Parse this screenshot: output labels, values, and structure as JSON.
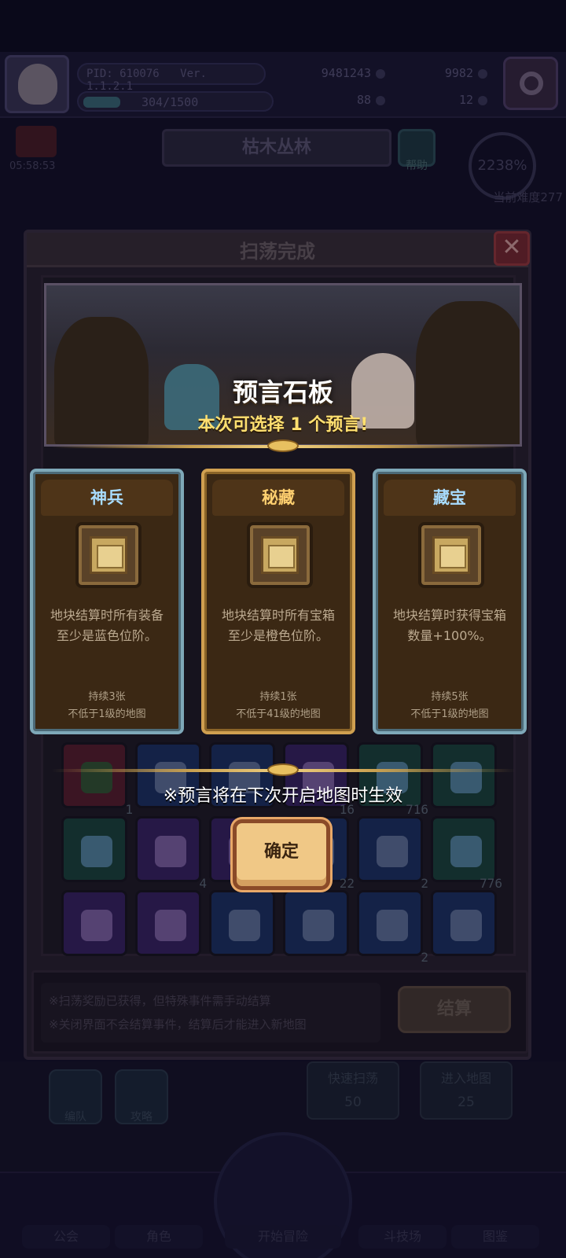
{
  "header": {
    "pid": "PID: 610076",
    "version": "Ver. 1.1.2.1",
    "exp": "304/1500",
    "exp_fraction": 0.2,
    "gold": "9481243",
    "gems": "9982",
    "resource_a": "88",
    "resource_b": "12",
    "timer": "05:58:53",
    "map_name": "枯木丛林",
    "help_label": "帮助",
    "progress_percent": "2238%",
    "difficulty": "当前难度277"
  },
  "dialog": {
    "title": "扫荡完成",
    "close_symbol": "✕",
    "notice_line1": "※扫荡奖励已获得，但特殊事件需手动结算",
    "notice_line2": "※关闭界面不会结算事件，结算后才能进入新地图",
    "settle_label": "结算",
    "item_rows": [
      [
        {
          "color": "red",
          "icon": "clover-icon",
          "count": "1"
        },
        {
          "color": "blue",
          "icon": "orb-icon",
          "count": ""
        },
        {
          "color": "blue",
          "icon": "scroll-icon",
          "count": ""
        },
        {
          "color": "purple",
          "icon": "gem-icon",
          "count": "16"
        },
        {
          "color": "green",
          "icon": "key-icon",
          "count": "716"
        },
        {
          "color": "green",
          "icon": "slime-icon",
          "count": ""
        }
      ],
      [
        {
          "color": "green",
          "icon": "witch-slime-icon",
          "count": ""
        },
        {
          "color": "purple",
          "icon": "mushroom-icon",
          "count": "4"
        },
        {
          "color": "purple",
          "icon": "bag-icon",
          "count": ""
        },
        {
          "color": "blue",
          "icon": "ore-icon",
          "count": "22"
        },
        {
          "color": "blue",
          "icon": "crystal-icon",
          "count": "2"
        },
        {
          "color": "green",
          "icon": "rune-icon",
          "count": "776"
        }
      ],
      [
        {
          "color": "purple",
          "icon": "necklace-icon",
          "count": ""
        },
        {
          "color": "purple",
          "icon": "heart-necklace-icon",
          "count": ""
        },
        {
          "color": "blue",
          "icon": "bow-icon",
          "count": ""
        },
        {
          "color": "blue",
          "icon": "staff-icon",
          "count": ""
        },
        {
          "color": "blue",
          "icon": "spear-icon",
          "count": "2"
        },
        {
          "color": "blue",
          "icon": "pearl-icon",
          "count": ""
        }
      ]
    ]
  },
  "bottom": {
    "team_label": "编队",
    "guide_label": "攻略",
    "quick_sweep_label": "快速扫荡",
    "quick_sweep_cost": "50",
    "enter_map_label": "进入地图",
    "enter_map_cost": "25",
    "nav": [
      "公会",
      "角色",
      "开始冒险",
      "斗技场",
      "图鉴"
    ]
  },
  "prophecy": {
    "title": "预言石板",
    "subtitle": "本次可选择 1 个预言!",
    "cards": [
      {
        "style": "blue",
        "name": "神兵",
        "desc_line1": "地块结算时所有装备",
        "desc_line2": "至少是蓝色位阶。",
        "duration": "持续3张",
        "requirement": "不低于1级的地图"
      },
      {
        "style": "gold",
        "name": "秘藏",
        "desc_line1": "地块结算时所有宝箱",
        "desc_line2": "至少是橙色位阶。",
        "duration": "持续1张",
        "requirement": "不低于41级的地图"
      },
      {
        "style": "blue",
        "name": "藏宝",
        "desc_line1": "地块结算时获得宝箱",
        "desc_line2": "数量+100%。",
        "duration": "持续5张",
        "requirement": "不低于1级的地图"
      }
    ],
    "effect_note": "※预言将在下次开启地图时生效",
    "confirm_label": "确定"
  }
}
